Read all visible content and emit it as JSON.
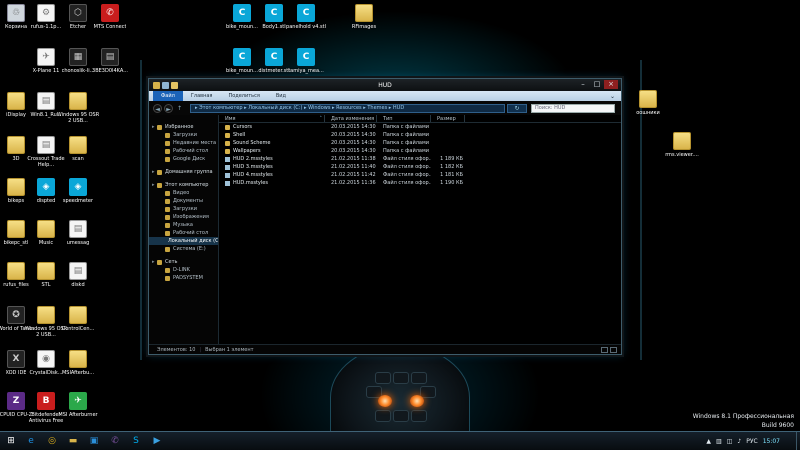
{
  "desktop": {
    "icons": [
      {
        "label": "Корзина",
        "kind": "bin",
        "glyph": "♲"
      },
      {
        "label": "rufus-1.1p...",
        "kind": "file",
        "glyph": "⚙"
      },
      {
        "label": "Etcher",
        "kind": "dark",
        "glyph": "⬡"
      },
      {
        "label": "MTS Connect",
        "kind": "red",
        "glyph": "✆"
      },
      {
        "label": "bike_moun...",
        "kind": "cyan",
        "glyph": "C"
      },
      {
        "label": "Body1.stl",
        "kind": "cyan",
        "glyph": "C"
      },
      {
        "label": "panelhold v4.stl",
        "kind": "cyan",
        "glyph": "C"
      },
      {
        "label": "RFimages",
        "kind": "folder",
        "glyph": ""
      },
      {
        "label": "X-Plane 11",
        "kind": "file",
        "glyph": "✈"
      },
      {
        "label": "chonoslik-li...",
        "kind": "dark",
        "glyph": "▦"
      },
      {
        "label": "3BE3D0I4KA...",
        "kind": "dark",
        "glyph": "▤"
      },
      {
        "label": "bike_moun...",
        "kind": "cyan",
        "glyph": "C"
      },
      {
        "label": "distmeter.stl",
        "kind": "cyan",
        "glyph": "C"
      },
      {
        "label": "tamiya_mea...",
        "kind": "cyan",
        "glyph": "C"
      },
      {
        "label": "iDisplay",
        "kind": "folder",
        "glyph": ""
      },
      {
        "label": "Win8.1_Ru...",
        "kind": "file",
        "glyph": "▤"
      },
      {
        "label": "Windows 95 OSR 2 USB...",
        "kind": "folder",
        "glyph": ""
      },
      {
        "label": "3D",
        "kind": "folder",
        "glyph": ""
      },
      {
        "label": "Crossout Trade Help...",
        "kind": "file",
        "glyph": "▤"
      },
      {
        "label": "scan",
        "kind": "folder",
        "glyph": ""
      },
      {
        "label": "bikeps",
        "kind": "folder",
        "glyph": ""
      },
      {
        "label": "dispted",
        "kind": "cyan",
        "glyph": "◈"
      },
      {
        "label": "speedmeter",
        "kind": "cyan",
        "glyph": "◈"
      },
      {
        "label": "bikepc_stl",
        "kind": "folder",
        "glyph": ""
      },
      {
        "label": "Music",
        "kind": "folder",
        "glyph": ""
      },
      {
        "label": "umessag",
        "kind": "file",
        "glyph": "▤"
      },
      {
        "label": "rufus_files",
        "kind": "folder",
        "glyph": ""
      },
      {
        "label": "STL",
        "kind": "folder",
        "glyph": ""
      },
      {
        "label": "diskd",
        "kind": "file",
        "glyph": "▤"
      },
      {
        "label": "World of Tanks",
        "kind": "dark",
        "glyph": "✪"
      },
      {
        "label": "Windows 95 OSR 2 USB...",
        "kind": "folder",
        "glyph": ""
      },
      {
        "label": "ControlCen...",
        "kind": "folder",
        "glyph": ""
      },
      {
        "label": "XOD IDE",
        "kind": "dark",
        "glyph": "X"
      },
      {
        "label": "CrystalDisk...",
        "kind": "file",
        "glyph": "◉"
      },
      {
        "label": "MSIAfterbu...",
        "kind": "folder",
        "glyph": ""
      },
      {
        "label": "CPUID CPU-Z",
        "kind": "purple",
        "glyph": "Z"
      },
      {
        "label": "Bitdefender Antivirus Free",
        "kind": "red",
        "glyph": "B"
      },
      {
        "label": "MSI Afterburner",
        "kind": "green",
        "glyph": "✈"
      },
      {
        "label": "оошники",
        "kind": "folder",
        "glyph": ""
      },
      {
        "label": "rms.viewer....",
        "kind": "folder",
        "glyph": ""
      }
    ]
  },
  "window": {
    "title": "HUD",
    "ribbon_tabs": [
      "Файл",
      "Главная",
      "Поделиться",
      "Вид"
    ],
    "ribbon_chevron": "⌄",
    "nav_back": "◄",
    "nav_forward": "►",
    "nav_up": "↑",
    "address": "▸ Этот компьютер ▸ Локальный диск (C:) ▸ Windows ▸ Resources ▸ Themes ▸ HUD",
    "address_refresh": "↻",
    "search_placeholder": "Поиск: HUD",
    "nav_pane": [
      {
        "label": "Избранное",
        "level": "top"
      },
      {
        "label": "Загрузки",
        "level": "sub"
      },
      {
        "label": "Недавние места",
        "level": "sub"
      },
      {
        "label": "Рабочий стол",
        "level": "sub"
      },
      {
        "label": "Google Диск",
        "level": "sub"
      },
      {
        "label": "",
        "level": "gap"
      },
      {
        "label": "Домашняя группа",
        "level": "top"
      },
      {
        "label": "",
        "level": "gap"
      },
      {
        "label": "Этот компьютер",
        "level": "top"
      },
      {
        "label": "Видео",
        "level": "sub"
      },
      {
        "label": "Документы",
        "level": "sub"
      },
      {
        "label": "Загрузки",
        "level": "sub"
      },
      {
        "label": "Изображения",
        "level": "sub"
      },
      {
        "label": "Музыка",
        "level": "sub"
      },
      {
        "label": "Рабочий стол",
        "level": "sub"
      },
      {
        "label": "Локальный диск (C:)",
        "level": "selected"
      },
      {
        "label": "Система (E:)",
        "level": "sub"
      },
      {
        "label": "",
        "level": "gap"
      },
      {
        "label": "Сеть",
        "level": "top"
      },
      {
        "label": "D-LINK",
        "level": "sub"
      },
      {
        "label": "PADSYSTEM",
        "level": "sub"
      }
    ],
    "columns": [
      "Имя",
      "Дата изменения",
      "Тип",
      "Размер"
    ],
    "sort_glyph": "˄",
    "files": [
      {
        "name": "Cursors",
        "date": "20.03.2015 14:30",
        "type": "Папка с файлами",
        "size": "",
        "kind": "folder"
      },
      {
        "name": "Shell",
        "date": "20.03.2015 14:30",
        "type": "Папка с файлами",
        "size": "",
        "kind": "folder"
      },
      {
        "name": "Sound Scheme",
        "date": "20.03.2015 14:30",
        "type": "Папка с файлами",
        "size": "",
        "kind": "folder"
      },
      {
        "name": "Wallpapers",
        "date": "20.03.2015 14:30",
        "type": "Папка с файлами",
        "size": "",
        "kind": "folder"
      },
      {
        "name": "HUD 2.msstyles",
        "date": "21.02.2015 11:38",
        "type": "Файл стиля офор...",
        "size": "1 189 КБ",
        "kind": "file"
      },
      {
        "name": "HUD 3.msstyles",
        "date": "21.02.2015 11:40",
        "type": "Файл стиля офор...",
        "size": "1 182 КБ",
        "kind": "file"
      },
      {
        "name": "HUD 4.msstyles",
        "date": "21.02.2015 11:42",
        "type": "Файл стиля офор...",
        "size": "1 181 КБ",
        "kind": "file"
      },
      {
        "name": "HUD.msstyles",
        "date": "21.02.2015 11:36",
        "type": "Файл стиля офор...",
        "size": "1 190 КБ",
        "kind": "file"
      }
    ],
    "status_count": "Элементов: 10",
    "status_selected": "Выбран 1 элемент"
  },
  "taskbar": {
    "start_glyph": "⊞",
    "apps": [
      {
        "name": "ie",
        "glyph": "e",
        "color": "#1d8fe0"
      },
      {
        "name": "chrome",
        "glyph": "◎",
        "color": "#e0b21d"
      },
      {
        "name": "explorer",
        "glyph": "▬",
        "color": "#d9b44a"
      },
      {
        "name": "store",
        "glyph": "▣",
        "color": "#2a8fd9"
      },
      {
        "name": "viber",
        "glyph": "✆",
        "color": "#7b519d"
      },
      {
        "name": "skype",
        "glyph": "S",
        "color": "#00aff0"
      },
      {
        "name": "media",
        "glyph": "▶",
        "color": "#3aa0e0"
      }
    ],
    "tray_arrow": "▲",
    "tray_icons": [
      "▥",
      "◫",
      "♪"
    ],
    "lang": "РУС",
    "time": "15:07"
  },
  "watermark": {
    "line1": "Windows 8.1 Профессиональная",
    "line2": "Build 9600"
  },
  "colors": {
    "accent": "#1b63b8",
    "window_border": "#3d5c6b",
    "clock": "#7fe4ff"
  }
}
